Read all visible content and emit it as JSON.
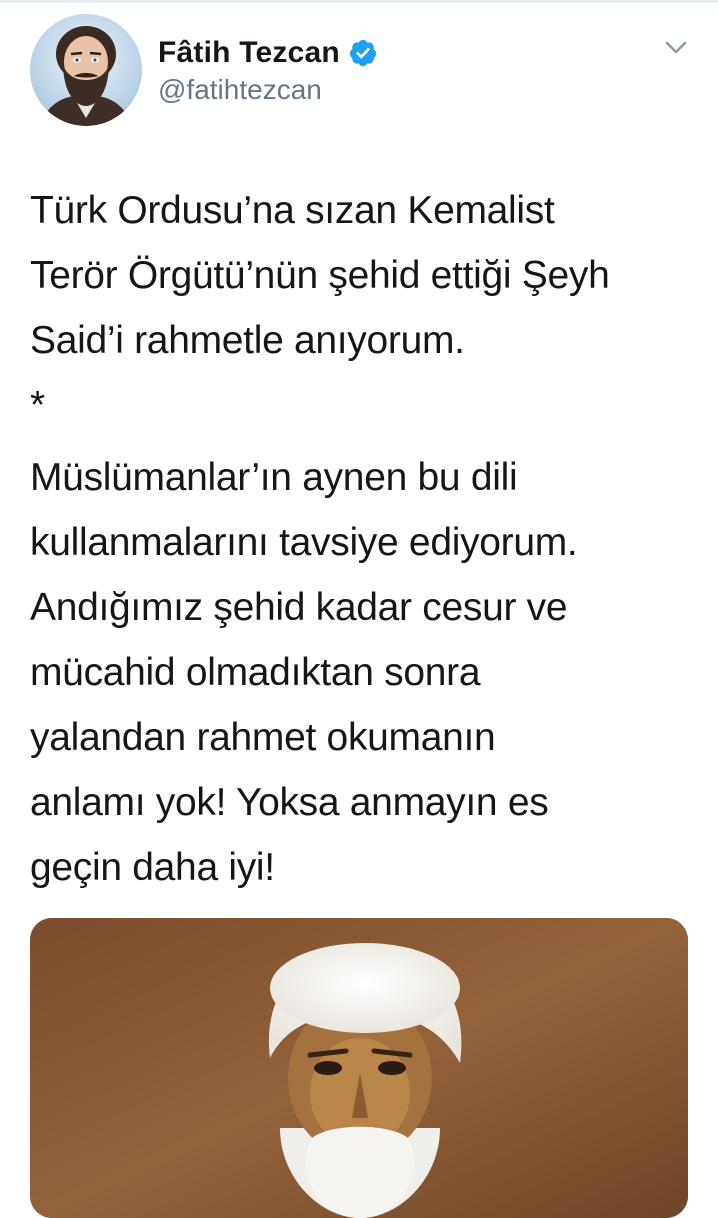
{
  "tweet": {
    "author": {
      "display_name": "Fâtih Tezcan",
      "handle": "@fatihtezcan",
      "verified": true,
      "verified_icon": "verified-badge-icon",
      "avatar": "avatar"
    },
    "menu_icon": "chevron-down-icon",
    "paragraphs": [
      "Türk Ordusu’na sızan Kemalist\nTerör Örgütü’nün şehid ettiği Şeyh\nSaid’i rahmetle anıyorum.\n*",
      "Müslümanlar’ın aynen bu dili\nkullanmalarını tavsiye ediyorum.\nAndığımız şehid kadar cesur ve\nmücahid olmadıktan sonra\nyalandan rahmet okumanın\nanlamı yok! Yoksa anmayın es\ngeçin daha iyi!"
    ],
    "media": {
      "type": "photo"
    }
  },
  "colors": {
    "verified_blue": "#1da1f2",
    "handle_gray": "#657786",
    "text": "#14171a",
    "divider": "#e6ecf0"
  }
}
